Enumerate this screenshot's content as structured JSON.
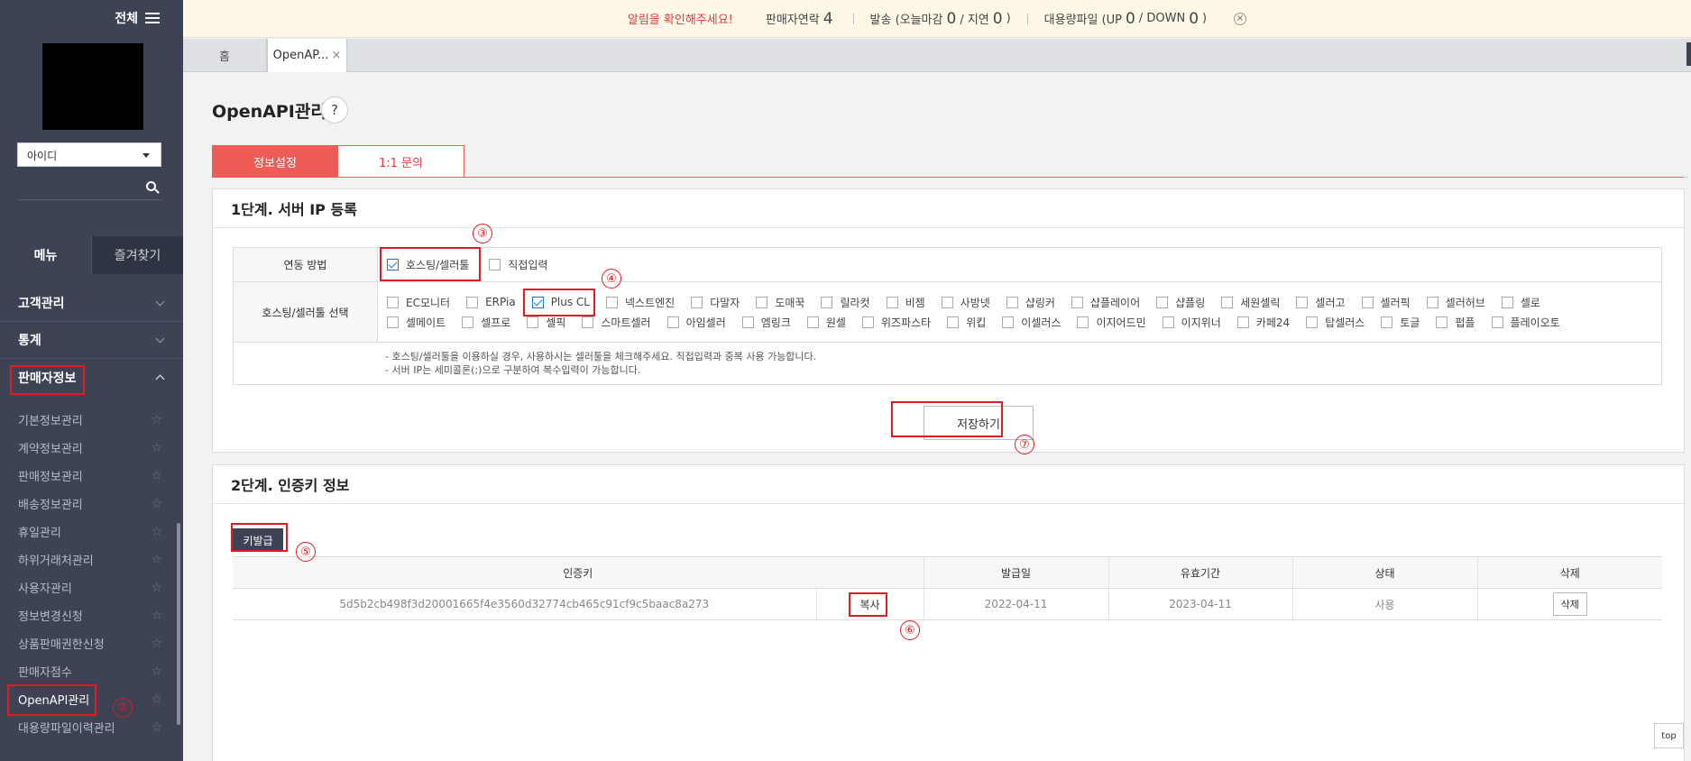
{
  "sidebar": {
    "all_label": "전체",
    "id_select": "아이디",
    "tabs": [
      "메뉴",
      "즐겨찾기"
    ],
    "categories": [
      {
        "label": "고객관리"
      },
      {
        "label": "통계"
      },
      {
        "label": "판매자정보"
      }
    ],
    "items": [
      "기본정보관리",
      "계약정보관리",
      "판매정보관리",
      "배송정보관리",
      "휴일관리",
      "하위거래처관리",
      "사용자관리",
      "정보변경신청",
      "상품판매권한신청",
      "판매자점수",
      "OpenAPI관리",
      "대용량파일이력관리"
    ]
  },
  "notice": {
    "alert": "알림을 확인해주세요!",
    "seller_contact_label": "판매자연락",
    "seller_contact_count": "4",
    "ship_label": "발송 (오늘마감",
    "ship_today": "0",
    "ship_delay_label": "/ 지연",
    "ship_delay": "0",
    "ship_close": ")",
    "bulk_label": "대용량파일 (UP",
    "bulk_up": "0",
    "bulk_down_label": "/ DOWN",
    "bulk_down": "0",
    "bulk_close": ")",
    "close_icon": "×"
  },
  "page_tabs": {
    "home": "홈",
    "current": "OpenAP...",
    "close": "×"
  },
  "page": {
    "title": "OpenAPI관리",
    "help": "?",
    "tabs": [
      "정보설정",
      "1:1 문의"
    ]
  },
  "step1": {
    "title": "1단계. 서버 IP 등록",
    "method_label": "연동 방법",
    "methods": [
      "호스팅/셀러툴",
      "직접입력"
    ],
    "select_label": "호스팅/셀러툴 선택",
    "tools_row1": [
      "EC모니터",
      "ERPia",
      "Plus CL",
      "넥스트엔진",
      "다말자",
      "도매꾹",
      "릴라컷",
      "비젬",
      "사방넷",
      "샵링커",
      "샵플레이어",
      "샵플링",
      "세원셀릭",
      "셀러고",
      "셀러픽",
      "셀러허브",
      "셀로"
    ],
    "tools_row2": [
      "셀메이트",
      "셀프로",
      "셀픽",
      "스마트셀러",
      "아임셀러",
      "엠링크",
      "원셀",
      "위즈파스타",
      "위킵",
      "이셀러스",
      "이지어드민",
      "이지위너",
      "카페24",
      "탑셀러스",
      "토글",
      "펍플",
      "플레이오토"
    ],
    "notes": [
      "- 호스팅/셀러툴을 이용하실 경우, 사용하시는 셀러툴을 체크해주세요. 직접입력과 중복 사용 가능합니다.",
      "- 서버 IP는 세미콜론(;)으로 구분하여 복수입력이 가능합니다."
    ],
    "save_label": "저장하기"
  },
  "step2": {
    "title": "2단계. 인증키 정보",
    "issue_label": "키발급",
    "columns": [
      "인증키",
      "발급일",
      "유효기간",
      "상태",
      "삭제"
    ],
    "row": {
      "key": "5d5b2cb498f3d20001665f4e3560d32774cb465c91cf9c5baac8a273",
      "copy": "복사",
      "issued": "2022-04-11",
      "expiry": "2023-04-11",
      "status": "사용",
      "delete": "삭제"
    }
  },
  "annotations": [
    "②",
    "③",
    "④",
    "⑤",
    "⑥",
    "⑦"
  ],
  "top_label": "top",
  "colors": {
    "accent": "#ef5b57",
    "sidebar": "#3d4354",
    "highlight": "#e01b22",
    "check": "#1e78d7"
  }
}
